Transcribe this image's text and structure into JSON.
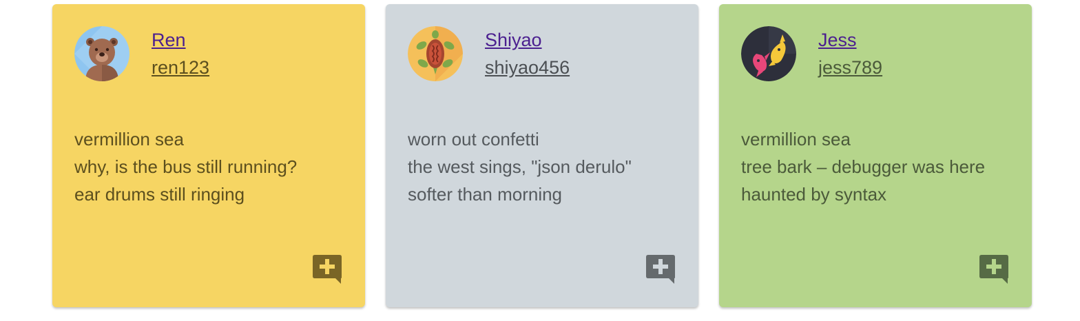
{
  "cards": [
    {
      "name": "Ren",
      "handle": "ren123",
      "lines": [
        "vermillion sea",
        "why, is the bus still running?",
        "ear drums still ringing"
      ],
      "avatar": "bear-avatar-icon",
      "colors": {
        "bg": "#f6d563",
        "text": "#5c4f1e",
        "handle": "#5c4f1e",
        "button": "#7a6526",
        "plus": "#f6d563"
      }
    },
    {
      "name": "Shiyao",
      "handle": "shiyao456",
      "lines": [
        "worn out confetti",
        "the west sings, \"json derulo\"",
        "softer than morning"
      ],
      "avatar": "turtle-avatar-icon",
      "colors": {
        "bg": "#d0d7dc",
        "text": "#555a5e",
        "handle": "#4b4f53",
        "button": "#656a6d",
        "plus": "#d0d7dc"
      }
    },
    {
      "name": "Jess",
      "handle": "jess789",
      "lines": [
        "vermillion sea",
        "tree bark – debugger was here",
        "haunted by syntax"
      ],
      "avatar": "fish-avatar-icon",
      "colors": {
        "bg": "#b5d58b",
        "text": "#4b5a3a",
        "handle": "#4b5a3a",
        "button": "#566b45",
        "plus": "#b5d58b"
      }
    }
  ]
}
